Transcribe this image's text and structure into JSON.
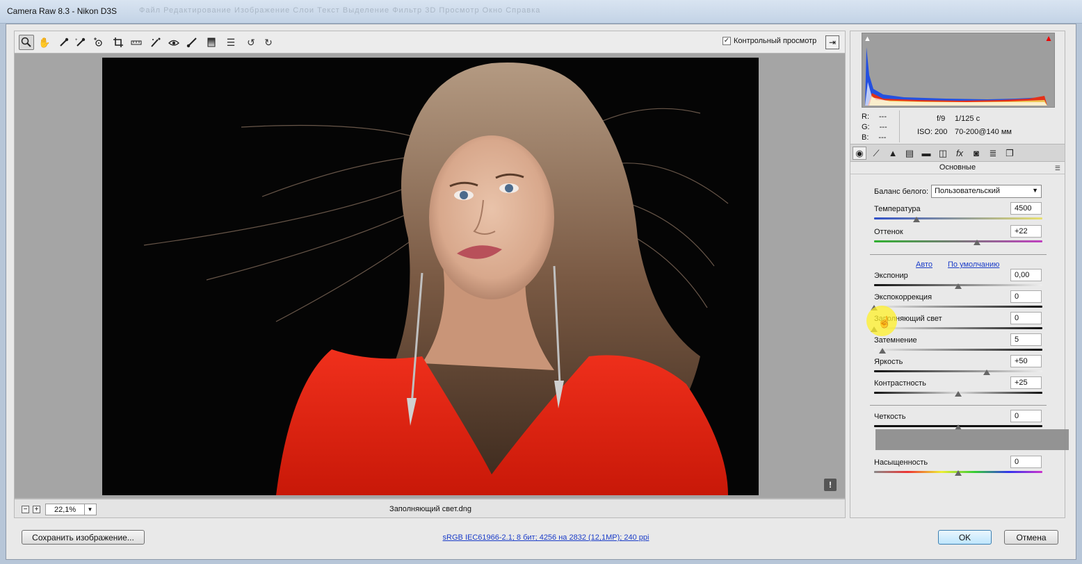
{
  "window": {
    "title": "Camera Raw 8.3  -  Nikon D3S",
    "background_menu": "Файл   Редактирование   Изображение   Слои   Текст   Выделение   Фильтр   3D   Просмотр   Окно   Справка"
  },
  "toolbar": {
    "tools": [
      "zoom-icon",
      "hand-icon",
      "white-balance-eyedropper-icon",
      "color-sampler-icon",
      "targeted-adjustment-icon",
      "crop-icon",
      "straighten-icon",
      "spot-removal-icon",
      "red-eye-icon",
      "adjustment-brush-icon",
      "graduated-filter-icon",
      "preferences-icon",
      "rotate-ccw-icon",
      "rotate-cw-icon"
    ],
    "preview_label": "Контрольный просмотр",
    "preview_checked": true
  },
  "status": {
    "zoom": "22,1%",
    "filename": "Заполняющий свет.dng",
    "warning": "!"
  },
  "histogram": {
    "rgb_labels": [
      "R:",
      "G:",
      "B:"
    ],
    "rgb_values": [
      "---",
      "---",
      "---"
    ],
    "aperture": "f/9",
    "shutter": "1/125 с",
    "iso": "ISO: 200",
    "lens": "70-200@140 мм"
  },
  "panel": {
    "title": "Основные",
    "white_balance_label": "Баланс белого:",
    "white_balance_value": "Пользовательский",
    "auto_link": "Авто",
    "default_link": "По умолчанию",
    "sliders": [
      {
        "label": "Температура",
        "value": "4500",
        "level": 0.25,
        "gradient": "linear-gradient(to right,#3050c8,#e8e070)"
      },
      {
        "label": "Оттенок",
        "value": "+22",
        "level": 0.61,
        "gradient": "linear-gradient(to right,#30b030,#c040c0)"
      },
      {
        "label": "Экспонир",
        "value": "0,00",
        "level": 0.5,
        "gradient": "linear-gradient(to right,#111,#eee)"
      },
      {
        "label": "Экспокоррекция",
        "value": "0",
        "level": 0.0,
        "gradient": "linear-gradient(to right,#eee,#111)"
      },
      {
        "label": "Заполняющий свет",
        "value": "0",
        "level": 0.0,
        "gradient": "linear-gradient(to right,#eee,#111)"
      },
      {
        "label": "Затемнение",
        "value": "5",
        "level": 0.05,
        "gradient": "linear-gradient(to right,#eee,#111)"
      },
      {
        "label": "Яркость",
        "value": "+50",
        "level": 0.67,
        "gradient": "linear-gradient(to right,#111,#eee)"
      },
      {
        "label": "Контрастность",
        "value": "+25",
        "level": 0.5,
        "gradient": "linear-gradient(to right,#111,#ddd,#111)"
      },
      {
        "label": "Четкость",
        "value": "0",
        "level": 0.5,
        "gradient": "linear-gradient(to right,#111,#111)"
      },
      {
        "label": "Насыщенность",
        "value": "0",
        "level": 0.5,
        "gradient": "linear-gradient(to right,#888,#e33,#ee3,#3c3,#33e,#c3c)"
      }
    ]
  },
  "footer": {
    "save_label": "Сохранить изображение...",
    "workflow_info": "sRGB IEC61966-2.1; 8 бит; 4256 на 2832 (12,1MP); 240 ppi",
    "ok_label": "OK",
    "cancel_label": "Отмена"
  }
}
